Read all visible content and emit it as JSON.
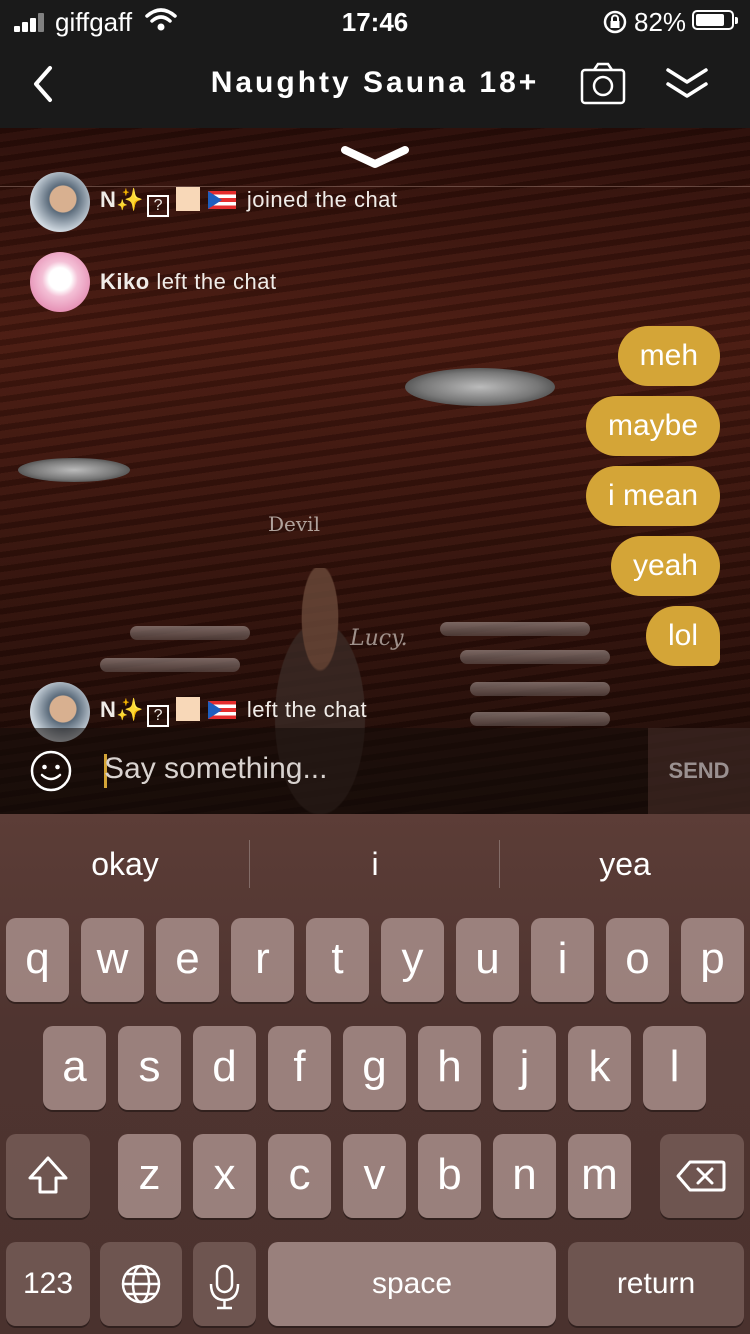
{
  "status_bar": {
    "carrier": "giffgaff",
    "time": "17:46",
    "battery": "82%"
  },
  "header": {
    "title": "Naughty Sauna 18+",
    "icons": [
      "back-chevron-icon",
      "camera-icon",
      "double-chevron-down-icon"
    ]
  },
  "scene": {
    "label_devil": "Devil",
    "label_lucy": "Lucy."
  },
  "chat": {
    "system_messages": [
      {
        "user_prefix": "N",
        "text": "joined the chat"
      },
      {
        "user": "Kiko",
        "text": "left the chat"
      },
      {
        "user_prefix": "N",
        "text": "left the chat"
      }
    ],
    "my_messages": [
      "meh",
      "maybe",
      "i mean",
      "yeah",
      "lol"
    ]
  },
  "input": {
    "placeholder": "Say something...",
    "send_label": "SEND"
  },
  "keyboard": {
    "suggestions": [
      "okay",
      "i",
      "yea"
    ],
    "row1": [
      "q",
      "w",
      "e",
      "r",
      "t",
      "y",
      "u",
      "i",
      "o",
      "p"
    ],
    "row2": [
      "a",
      "s",
      "d",
      "f",
      "g",
      "h",
      "j",
      "k",
      "l"
    ],
    "row3": [
      "z",
      "x",
      "c",
      "v",
      "b",
      "n",
      "m"
    ],
    "numbers_label": "123",
    "space_label": "space",
    "return_label": "return"
  },
  "colors": {
    "accent": "#d4a537",
    "header_bg": "#1a1a1a"
  }
}
